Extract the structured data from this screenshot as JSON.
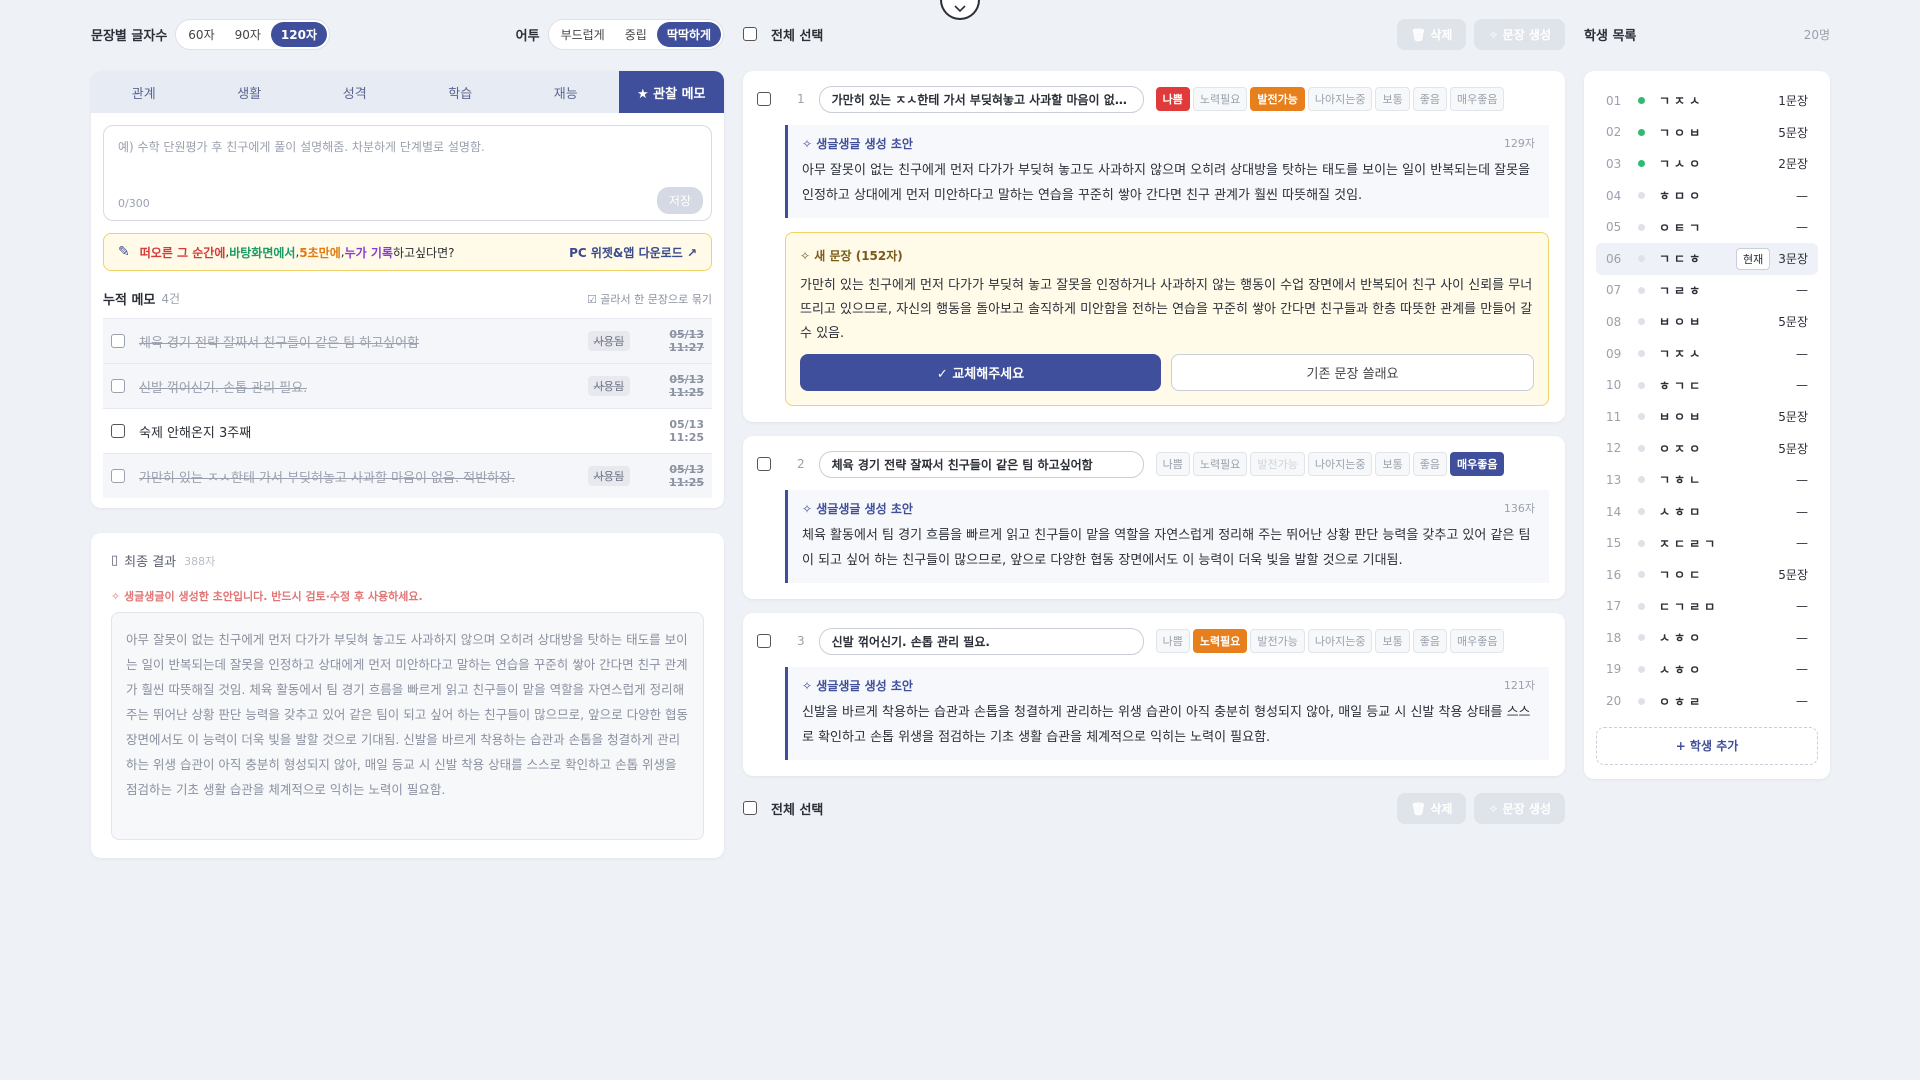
{
  "options": {
    "length_label": "문장별 글자수",
    "length_options": [
      "60자",
      "90자",
      "120자"
    ],
    "length_selected": 2,
    "tone_label": "어투",
    "tone_options": [
      "부드럽게",
      "중립",
      "딱딱하게"
    ],
    "tone_selected": 2
  },
  "memo": {
    "tabs": [
      "관계",
      "생활",
      "성격",
      "학습",
      "재능",
      "★ 관찰 메모"
    ],
    "active_tab": 5,
    "placeholder": "예) 수학 단원평가 후 친구에게 풀이 설명해줌. 차분하게 단계별로 설명함.",
    "counter": "0/300",
    "save_label": "저장",
    "promo": {
      "t1": "떠오른 그 순간에",
      "sep1": ", ",
      "t2": "바탕화면에서",
      "sep2": ", ",
      "t3": "5초만에",
      "sep3": ", ",
      "t4": "누가 기록",
      "t5": " 하고싶다면?",
      "download": "PC 위젯&앱 다운로드 ↗"
    },
    "accum_title": "누적 메모",
    "accum_count": "4건",
    "accum_action": "☑ 골라서 한 문장으로 묶기",
    "items": [
      {
        "text": "체육 경기 전략 잘짜서 친구들이 같은 팀 하고싶어함",
        "tag": "사용됨",
        "time": "05/13 11:27",
        "used": true
      },
      {
        "text": "신발 꺾어신기. 손톱 관리 필요.",
        "tag": "사용됨",
        "time": "05/13 11:25",
        "used": true
      },
      {
        "text": "숙제 안해온지 3주째",
        "tag": "",
        "time": "05/13 11:25",
        "used": false
      },
      {
        "text": "가만히 있는 ㅈㅅ한테 가서 부딪혀놓고 사과할 마음이 없음. 적반하장.",
        "tag": "사용됨",
        "time": "05/13 11:25",
        "used": true
      }
    ]
  },
  "final": {
    "title": "최종 결과",
    "count": "388자",
    "warning": "✧ 생글생글이 생성한 초안입니다. 반드시 검토·수정 후 사용하세요.",
    "text": "아무 잘못이 없는 친구에게 먼저 다가가 부딪혀 놓고도 사과하지 않으며 오히려 상대방을 탓하는 태도를 보이는 일이 반복되는데 잘못을 인정하고 상대에게 먼저 미안하다고 말하는 연습을 꾸준히 쌓아 간다면 친구 관계가 훨씬 따뜻해질 것임. 체육 활동에서 팀 경기 흐름을 빠르게 읽고 친구들이 맡을 역할을 자연스럽게 정리해 주는 뛰어난 상황 판단 능력을 갖추고 있어 같은 팀이 되고 싶어 하는 친구들이 많으므로, 앞으로 다양한 협동 장면에서도 이 능력이 더욱 빛을 발할 것으로 기대됨. 신발을 바르게 착용하는 습관과 손톱을 청결하게 관리하는 위생 습관이 아직 충분히 형성되지 않아, 매일 등교 시 신발 착용 상태를 스스로 확인하고 손톱 위생을 점검하는 기초 생활 습관을 체계적으로 익히는 노력이 필요함."
  },
  "center": {
    "select_all": "전체 선택",
    "delete": "🗑 삭제",
    "generate": "✧ 문장 생성",
    "grades": [
      "나쁨",
      "노력필요",
      "발전가능",
      "나아지는중",
      "보통",
      "좋음",
      "매우좋음"
    ],
    "draft_label": "✧ 생글생글 생성 초안",
    "sentences": [
      {
        "num": "1",
        "memo": "가만히 있는 ㅈㅅ한테 가서 부딪혀놓고 사과할 마음이 없음. 적반하장.",
        "draft_len": "129자",
        "draft": "아무 잘못이 없는 친구에게 먼저 다가가 부딪혀 놓고도 사과하지 않으며 오히려 상대방을 탓하는 태도를 보이는 일이 반복되는데 잘못을 인정하고 상대에게 먼저 미안하다고 말하는 연습을 꾸준히 쌓아 간다면 친구 관계가 훨씬 따뜻해질 것임.",
        "new_label": "✧ 새 문장 (152자)",
        "new_text": "가만히 있는 친구에게 먼저 다가가 부딪혀 놓고 잘못을 인정하거나 사과하지 않는 행동이 수업 장면에서 반복되어 친구 사이 신뢰를 무너뜨리고 있으므로, 자신의 행동을 돌아보고 솔직하게 미안함을 전하는 연습을 꾸준히 쌓아 간다면 친구들과 한층 따뜻한 관계를 만들어 갈 수 있음.",
        "accept": "✓ 교체해주세요",
        "keep": "기존 문장 쓸래요"
      },
      {
        "num": "2",
        "memo": "체육 경기 전략 잘짜서 친구들이 같은 팀 하고싶어함",
        "draft_len": "136자",
        "draft": "체육 활동에서 팀 경기 흐름을 빠르게 읽고 친구들이 맡을 역할을 자연스럽게 정리해 주는 뛰어난 상황 판단 능력을 갖추고 있어 같은 팀이 되고 싶어 하는 친구들이 많으므로, 앞으로 다양한 협동 장면에서도 이 능력이 더욱 빛을 발할 것으로 기대됨."
      },
      {
        "num": "3",
        "memo": "신발 꺾어신기. 손톱 관리 필요.",
        "draft_len": "121자",
        "draft": "신발을 바르게 착용하는 습관과 손톱을 청결하게 관리하는 위생 습관이 아직 충분히 형성되지 않아, 매일 등교 시 신발 착용 상태를 스스로 확인하고 손톱 위생을 점검하는 기초 생활 습관을 체계적으로 익히는 노력이 필요함."
      }
    ]
  },
  "students": {
    "title": "학생 목록",
    "count": "20명",
    "current_label": "현재",
    "add_label": "+ 학생 추가",
    "list": [
      {
        "no": "01",
        "name": "ㄱㅈㅅ",
        "sentences": "1문장",
        "active": true
      },
      {
        "no": "02",
        "name": "ㄱㅇㅂ",
        "sentences": "5문장",
        "active": true
      },
      {
        "no": "03",
        "name": "ㄱㅅㅇ",
        "sentences": "2문장",
        "active": true
      },
      {
        "no": "04",
        "name": "ㅎㅁㅇ",
        "sentences": "—",
        "active": false
      },
      {
        "no": "05",
        "name": "ㅇㅌㄱ",
        "sentences": "—",
        "active": false
      },
      {
        "no": "06",
        "name": "ㄱㄷㅎ",
        "sentences": "3문장",
        "active": false,
        "current": true
      },
      {
        "no": "07",
        "name": "ㄱㄹㅎ",
        "sentences": "—",
        "active": false
      },
      {
        "no": "08",
        "name": "ㅂㅇㅂ",
        "sentences": "5문장",
        "active": false
      },
      {
        "no": "09",
        "name": "ㄱㅈㅅ",
        "sentences": "—",
        "active": false
      },
      {
        "no": "10",
        "name": "ㅎㄱㄷ",
        "sentences": "—",
        "active": false
      },
      {
        "no": "11",
        "name": "ㅂㅇㅂ",
        "sentences": "5문장",
        "active": false
      },
      {
        "no": "12",
        "name": "ㅇㅈㅇ",
        "sentences": "5문장",
        "active": false
      },
      {
        "no": "13",
        "name": "ㄱㅎㄴ",
        "sentences": "—",
        "active": false
      },
      {
        "no": "14",
        "name": "ㅅㅎㅁ",
        "sentences": "—",
        "active": false
      },
      {
        "no": "15",
        "name": "ㅈㄷㄹㄱ",
        "sentences": "—",
        "active": false
      },
      {
        "no": "16",
        "name": "ㄱㅇㄷ",
        "sentences": "5문장",
        "active": false
      },
      {
        "no": "17",
        "name": "ㄷㄱㄹㅁ",
        "sentences": "—",
        "active": false
      },
      {
        "no": "18",
        "name": "ㅅㅎㅇ",
        "sentences": "—",
        "active": false
      },
      {
        "no": "19",
        "name": "ㅅㅎㅇ",
        "sentences": "—",
        "active": false
      },
      {
        "no": "20",
        "name": "ㅇㅎㄹ",
        "sentences": "—",
        "active": false
      }
    ]
  }
}
